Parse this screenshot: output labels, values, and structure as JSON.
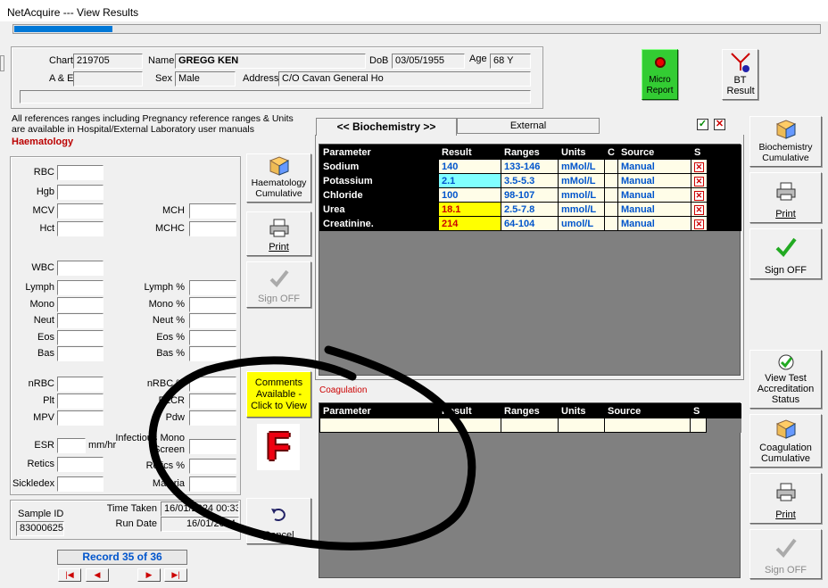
{
  "window": {
    "title": "NetAcquire --- View Results",
    "progress": 0.12
  },
  "patient": {
    "chart_label": "Chart",
    "chart": "219705",
    "name_label": "Name",
    "name": "GREGG KEN",
    "dob_label": "DoB",
    "dob": "03/05/1955",
    "age_label": "Age",
    "age": "68 Y",
    "ae_label": "A & E",
    "ae": "",
    "sex_label": "Sex",
    "sex": "Male",
    "address_label": "Address",
    "address": "C/O Cavan General Ho"
  },
  "buttons": {
    "micro": "Micro Report",
    "bt": "BT Result",
    "biochem_cum": "Biochemistry Cumulative",
    "print": "Print",
    "sign_off": "Sign OFF",
    "view_test": "View Test Accreditation Status",
    "coag_cum": "Coagulation Cumulative",
    "haem_cum": "Haematology Cumulative",
    "comments": "Comments Available - Click to View",
    "flag": "F",
    "cancel": "Cancel"
  },
  "note": "All references ranges including Pregnancy reference ranges & Units are available in Hospital/External Laboratory user manuals",
  "haematology": {
    "title": "Haematology",
    "left": [
      "RBC",
      "Hgb",
      "MCV",
      "Hct",
      "WBC",
      "Lymph",
      "Mono",
      "Neut",
      "Eos",
      "Bas",
      "nRBC",
      "Plt",
      "MPV",
      "ESR",
      "Retics",
      "Sickledex"
    ],
    "right": [
      "MCH",
      "MCHC",
      "Lymph %",
      "Mono %",
      "Neut %",
      "Eos %",
      "Bas %",
      "nRBC %",
      "PLCR",
      "Pdw",
      "Infectious Mono Screen",
      "Retics %",
      "Malaria"
    ],
    "esr_unit": "mm/hr"
  },
  "sample": {
    "id_label": "Sample ID",
    "id": "83000625",
    "time_label": "Time Taken",
    "time": "16/01/2024 00:33",
    "run_label": "Run Date",
    "run": "16/01/2024"
  },
  "record": "Record 35 of 36",
  "tabs": {
    "biochem": "<< Biochemistry >>",
    "external": "External"
  },
  "biochem": {
    "headers": [
      "Parameter",
      "Result",
      "Ranges",
      "Units",
      "C",
      "Source",
      "S"
    ],
    "rows": [
      {
        "param": "Sodium",
        "result": "140",
        "range": "133-146",
        "unit": "mMol/L",
        "source": "Manual",
        "bg": ""
      },
      {
        "param": "Potassium",
        "result": "2.1",
        "range": "3.5-5.3",
        "unit": "mMol/L",
        "source": "Manual",
        "bg": "#80ffff"
      },
      {
        "param": "Chloride",
        "result": "100",
        "range": "98-107",
        "unit": "mmol/L",
        "source": "Manual",
        "bg": ""
      },
      {
        "param": "Urea",
        "result": "18.1",
        "range": "2.5-7.8",
        "unit": "mmol/L",
        "source": "Manual",
        "bg": "#ffff00"
      },
      {
        "param": "Creatinine.",
        "result": "214",
        "range": "64-104",
        "unit": "umol/L",
        "source": "Manual",
        "bg": "#ffff00"
      }
    ]
  },
  "coag": {
    "label": "Coagulation",
    "headers": [
      "Parameter",
      "Result",
      "Ranges",
      "Units",
      "Source",
      "S"
    ]
  }
}
